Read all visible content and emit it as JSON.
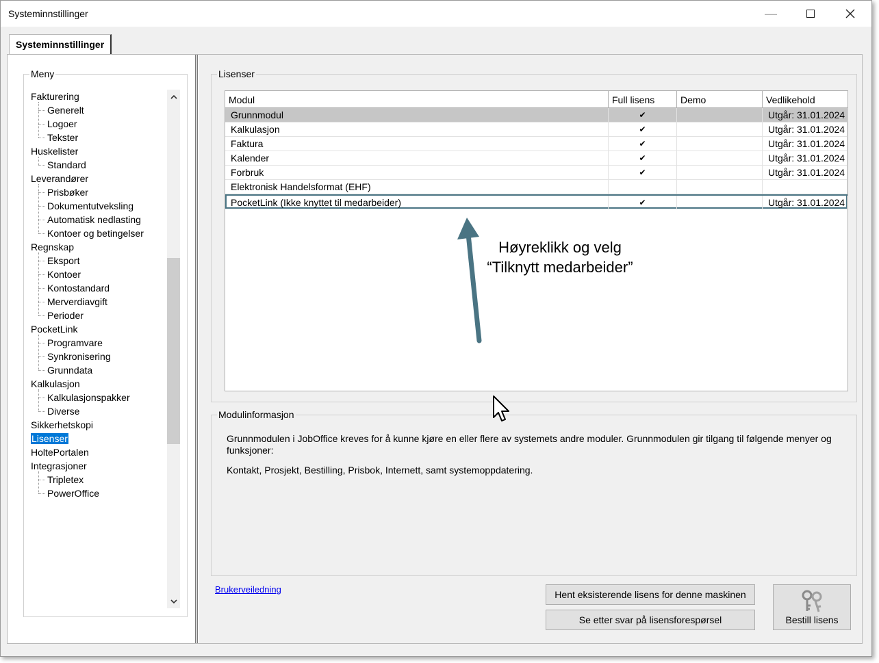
{
  "window": {
    "title": "Systeminnstillinger"
  },
  "tabs": [
    {
      "label": "Systeminnstillinger"
    }
  ],
  "menu": {
    "label": "Meny",
    "items": [
      {
        "label": "Fakturering",
        "level": 0
      },
      {
        "label": "Generelt",
        "level": 1
      },
      {
        "label": "Logoer",
        "level": 1
      },
      {
        "label": "Tekster",
        "level": 1
      },
      {
        "label": "Huskelister",
        "level": 0
      },
      {
        "label": "Standard",
        "level": 1
      },
      {
        "label": "Leverandører",
        "level": 0
      },
      {
        "label": "Prisbøker",
        "level": 1
      },
      {
        "label": "Dokumentutveksling",
        "level": 1
      },
      {
        "label": "Automatisk nedlasting",
        "level": 1
      },
      {
        "label": "Kontoer og betingelser",
        "level": 1
      },
      {
        "label": "Regnskap",
        "level": 0
      },
      {
        "label": "Eksport",
        "level": 1
      },
      {
        "label": "Kontoer",
        "level": 1
      },
      {
        "label": "Kontostandard",
        "level": 1
      },
      {
        "label": "Merverdiavgift",
        "level": 1
      },
      {
        "label": "Perioder",
        "level": 1
      },
      {
        "label": "PocketLink",
        "level": 0
      },
      {
        "label": "Programvare",
        "level": 1
      },
      {
        "label": "Synkronisering",
        "level": 1
      },
      {
        "label": "Grunndata",
        "level": 1
      },
      {
        "label": "Kalkulasjon",
        "level": 0
      },
      {
        "label": "Kalkulasjonspakker",
        "level": 1
      },
      {
        "label": "Diverse",
        "level": 1
      },
      {
        "label": "Sikkerhetskopi",
        "level": 0
      },
      {
        "label": "Lisenser",
        "level": 0,
        "selected": true
      },
      {
        "label": "HoltePortalen",
        "level": 0
      },
      {
        "label": "Integrasjoner",
        "level": 0
      },
      {
        "label": "Tripletex",
        "level": 1
      },
      {
        "label": "PowerOffice",
        "level": 1
      }
    ]
  },
  "licenses": {
    "label": "Lisenser",
    "columns": [
      "Modul",
      "Full lisens",
      "Demo",
      "Vedlikehold"
    ],
    "rows": [
      {
        "module": "Grunnmodul",
        "full": "✔",
        "demo": "",
        "maintenance": "Utgår: 31.01.2024",
        "selected": true
      },
      {
        "module": "Kalkulasjon",
        "full": "✔",
        "demo": "",
        "maintenance": "Utgår: 31.01.2024"
      },
      {
        "module": "Faktura",
        "full": "✔",
        "demo": "",
        "maintenance": "Utgår: 31.01.2024"
      },
      {
        "module": "Kalender",
        "full": "✔",
        "demo": "",
        "maintenance": "Utgår: 31.01.2024"
      },
      {
        "module": "Forbruk",
        "full": "✔",
        "demo": "",
        "maintenance": "Utgår: 31.01.2024"
      },
      {
        "module": "Elektronisk Handelsformat (EHF)",
        "full": "",
        "demo": "",
        "maintenance": ""
      },
      {
        "module": "PocketLink (Ikke knyttet til medarbeider)",
        "full": "✔",
        "demo": "",
        "maintenance": "Utgår: 31.01.2024",
        "focused": true
      }
    ]
  },
  "annotation": {
    "line1": "Høyreklikk og velg",
    "line2": "“Tilknytt medarbeider”"
  },
  "module_info": {
    "label": "Modulinformasjon",
    "paragraph1": "Grunnmodulen i JobOffice kreves for å kunne kjøre en eller flere av systemets andre moduler. Grunnmodulen gir tilgang til følgende menyer og funksjoner:",
    "paragraph2": "Kontakt, Prosjekt, Bestilling, Prisbok, Internett, samt systemoppdatering."
  },
  "footer": {
    "help_link": "Brukerveiledning",
    "fetch_button": "Hent eksisterende lisens for denne maskinen",
    "check_button": "Se etter svar på lisensforespørsel",
    "order_button": "Bestill lisens"
  },
  "colors": {
    "selection": "#0078d7",
    "arrow": "#4a7483",
    "row_selected": "#c6c6c6"
  }
}
